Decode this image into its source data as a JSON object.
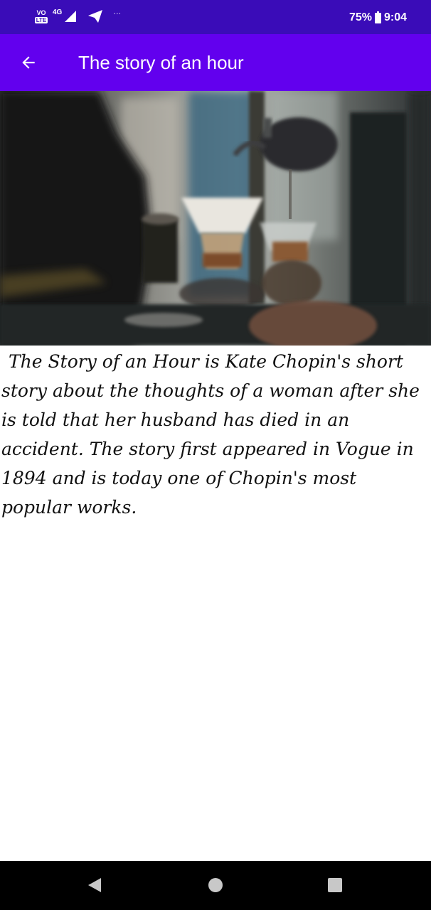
{
  "status_bar": {
    "volte_top": "VO",
    "volte_bottom": "LTE",
    "network": "4G",
    "more_glyph": "···",
    "battery": "75%",
    "time": "9:04"
  },
  "app_bar": {
    "title": "The story of an hour"
  },
  "hero": {
    "icon": "coffee-bar-photo"
  },
  "content": {
    "paragraph": "The Story of an Hour is Kate Chopin's short story about the thoughts of a woman after she is told that her husband has died in an accident. The story first appeared in Vogue in 1894 and is today one of Chopin's most popular works."
  },
  "colors": {
    "status_bar": "#3a0cb8",
    "app_bar": "#6200ee",
    "nav_bar": "#000000",
    "text": "#111111"
  }
}
